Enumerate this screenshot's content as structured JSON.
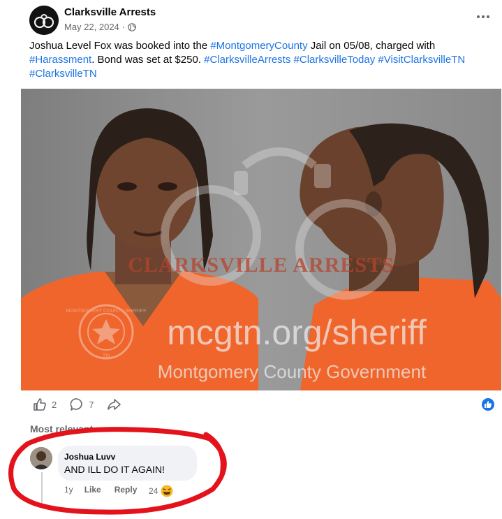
{
  "post": {
    "page_name": "Clarksville Arrests",
    "date": "May 22, 2024",
    "separator": "·",
    "audience_icon": "globe-icon",
    "more_icon": "more-options-icon",
    "caption": {
      "t1": "Joshua Level Fox was booked into the ",
      "h1": "#MontgomeryCounty",
      "t2": " Jail on 05/08, charged with ",
      "h2": "#Harassment",
      "t3": ". Bond was set at $250. ",
      "h3": "#ClarksvilleArrests",
      "h4": "#ClarksvilleToday",
      "h5": "#VisitClarksvilleTN",
      "h6": "#ClarksvilleTN"
    },
    "photo": {
      "watermark_brand": "CLARKSVILLE ARRESTS",
      "watermark_url": "mcgtn.org/sheriff",
      "watermark_org": "Montgomery County Government",
      "seal_text": "MONTGOMERY COUNTY SHERIFF",
      "seal_state": "TN"
    },
    "actions": {
      "like_count": "2",
      "comment_count": "7",
      "like_icon": "thumbs-up-icon",
      "comment_icon": "comment-icon",
      "share_icon": "share-icon",
      "reaction_badge_icon": "like-reaction-icon"
    }
  },
  "comments": {
    "sort_label": "Most relevant",
    "items": [
      {
        "author": "Joshua Luvv",
        "text": "AND ILL DO IT AGAIN!",
        "time": "1y",
        "like_label": "Like",
        "reply_label": "Reply",
        "reaction_count": "24",
        "reaction_icon": "laughing-emoji-icon"
      }
    ]
  },
  "colors": {
    "link": "#1b74e4",
    "text": "#050505",
    "secondary": "#65676b",
    "bubble": "#f0f2f5",
    "annotation": "#e4121b"
  }
}
